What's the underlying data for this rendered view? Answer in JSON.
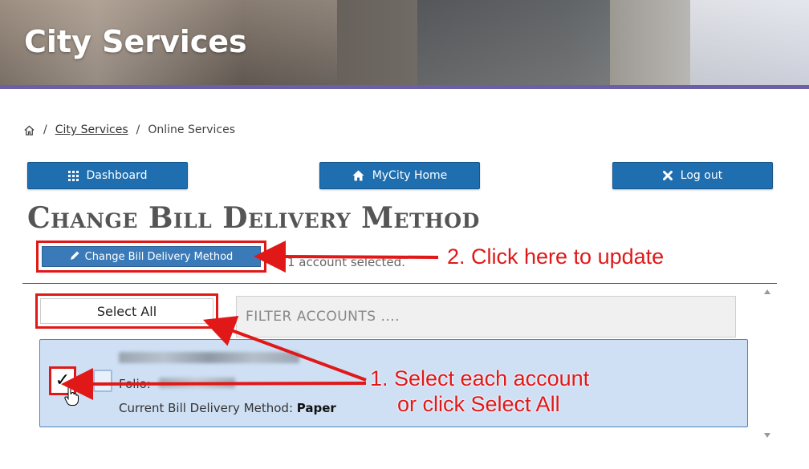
{
  "banner": {
    "title": "City Services"
  },
  "breadcrumb": {
    "home_icon": "home-icon",
    "link": "City Services",
    "current": "Online Services",
    "separator": "/"
  },
  "nav": {
    "dashboard": {
      "label": "Dashboard",
      "icon": "grid-icon"
    },
    "home": {
      "label": "MyCity Home",
      "icon": "home-icon"
    },
    "logout": {
      "label": "Log out",
      "icon": "close-icon"
    }
  },
  "page": {
    "title": "Change Bill Delivery Method"
  },
  "actions": {
    "change_label": "Change Bill Delivery Method",
    "change_icon": "pencil-icon",
    "selected_text": "1 account selected."
  },
  "list": {
    "select_all_label": "Select All",
    "filter_placeholder": "FILTER ACCOUNTS ....",
    "account": {
      "folio_label": "Folio:",
      "method_label": "Current Bill Delivery Method:",
      "method_value": "Paper",
      "checked": true
    }
  },
  "annotations": {
    "step2": "2. Click here to update",
    "step1_line1": "1. Select each account",
    "step1_line2": "or click Select All",
    "color": "#e01818"
  },
  "colors": {
    "primary_button": "#1e6eb0",
    "accent_bar": "#6b5fa8",
    "card_bg": "#cfe0f5"
  }
}
